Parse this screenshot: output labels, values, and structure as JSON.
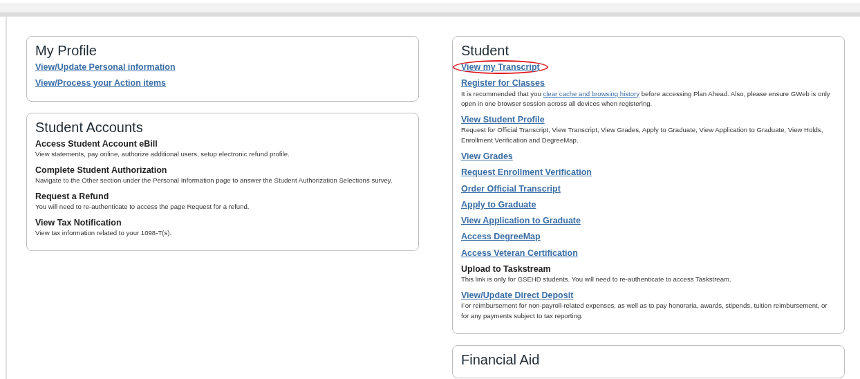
{
  "columns": [
    {
      "cards": [
        {
          "title": "My Profile",
          "items": [
            {
              "kind": "link",
              "label": "View/Update Personal information",
              "highlighted": false
            },
            {
              "kind": "link",
              "label": "View/Process your Action items",
              "highlighted": false
            }
          ]
        },
        {
          "title": "Student Accounts",
          "items": [
            {
              "kind": "heading",
              "label": "Access Student Account eBill",
              "description": [
                {
                  "kind": "text",
                  "text": "View statements, pay online, authorize additional users, setup electronic refund profile."
                }
              ]
            },
            {
              "kind": "heading",
              "label": "Complete Student Authorization",
              "description": [
                {
                  "kind": "text",
                  "text": "Navigate to the Other section under the Personal Information page to answer the Student Authorization Selections survey."
                }
              ]
            },
            {
              "kind": "heading",
              "label": "Request a Refund",
              "description": [
                {
                  "kind": "text",
                  "text": "You will need to re-authenticate to access the page Request for a refund."
                }
              ]
            },
            {
              "kind": "heading",
              "label": "View Tax Notification",
              "description": [
                {
                  "kind": "text",
                  "text": "View tax information related to your 1098-T(s)."
                }
              ]
            }
          ]
        }
      ]
    },
    {
      "cards": [
        {
          "title": "Student",
          "items": [
            {
              "kind": "link",
              "label": "View my Transcript",
              "highlighted": true
            },
            {
              "kind": "link",
              "label": "Register for Classes",
              "highlighted": false,
              "description": [
                {
                  "kind": "text",
                  "text": "It is recommended that you"
                },
                {
                  "kind": "link",
                  "text": "clear cache and browsing history"
                },
                {
                  "kind": "text",
                  "text": "before accessing Plan Ahead. Also, please ensure GWeb is only open in one browser session across all devices when registering."
                }
              ]
            },
            {
              "kind": "link",
              "label": "View Student Profile",
              "highlighted": false,
              "description": [
                {
                  "kind": "text",
                  "text": "Request for Official Transcript, View Transcript, View Grades, Apply to Graduate, View Application to Graduate, View Holds, Enrollment Verification and DegreeMap."
                }
              ]
            },
            {
              "kind": "link",
              "label": "View Grades",
              "highlighted": false
            },
            {
              "kind": "link",
              "label": "Request Enrollment Verification",
              "highlighted": false
            },
            {
              "kind": "link",
              "label": "Order Official Transcript",
              "highlighted": false
            },
            {
              "kind": "link",
              "label": "Apply to Graduate",
              "highlighted": false
            },
            {
              "kind": "link",
              "label": "View Application to Graduate",
              "highlighted": false
            },
            {
              "kind": "link",
              "label": "Access DegreeMap",
              "highlighted": false
            },
            {
              "kind": "link",
              "label": "Access Veteran Certification",
              "highlighted": false
            },
            {
              "kind": "heading",
              "label": "Upload to Taskstream",
              "description": [
                {
                  "kind": "text",
                  "text": "This link is only for GSEHD students. You will need to re-authenticate to access Taskstream."
                }
              ]
            },
            {
              "kind": "link",
              "label": "View/Update Direct Deposit",
              "highlighted": false,
              "description": [
                {
                  "kind": "text",
                  "text": "For reimbursement for non-payroll-related expenses, as well as to pay honoraria, awards, stipends, tuition reimbursement, or for any payments subject to tax reporting."
                }
              ]
            }
          ]
        },
        {
          "title": "Financial Aid"
        }
      ]
    }
  ]
}
